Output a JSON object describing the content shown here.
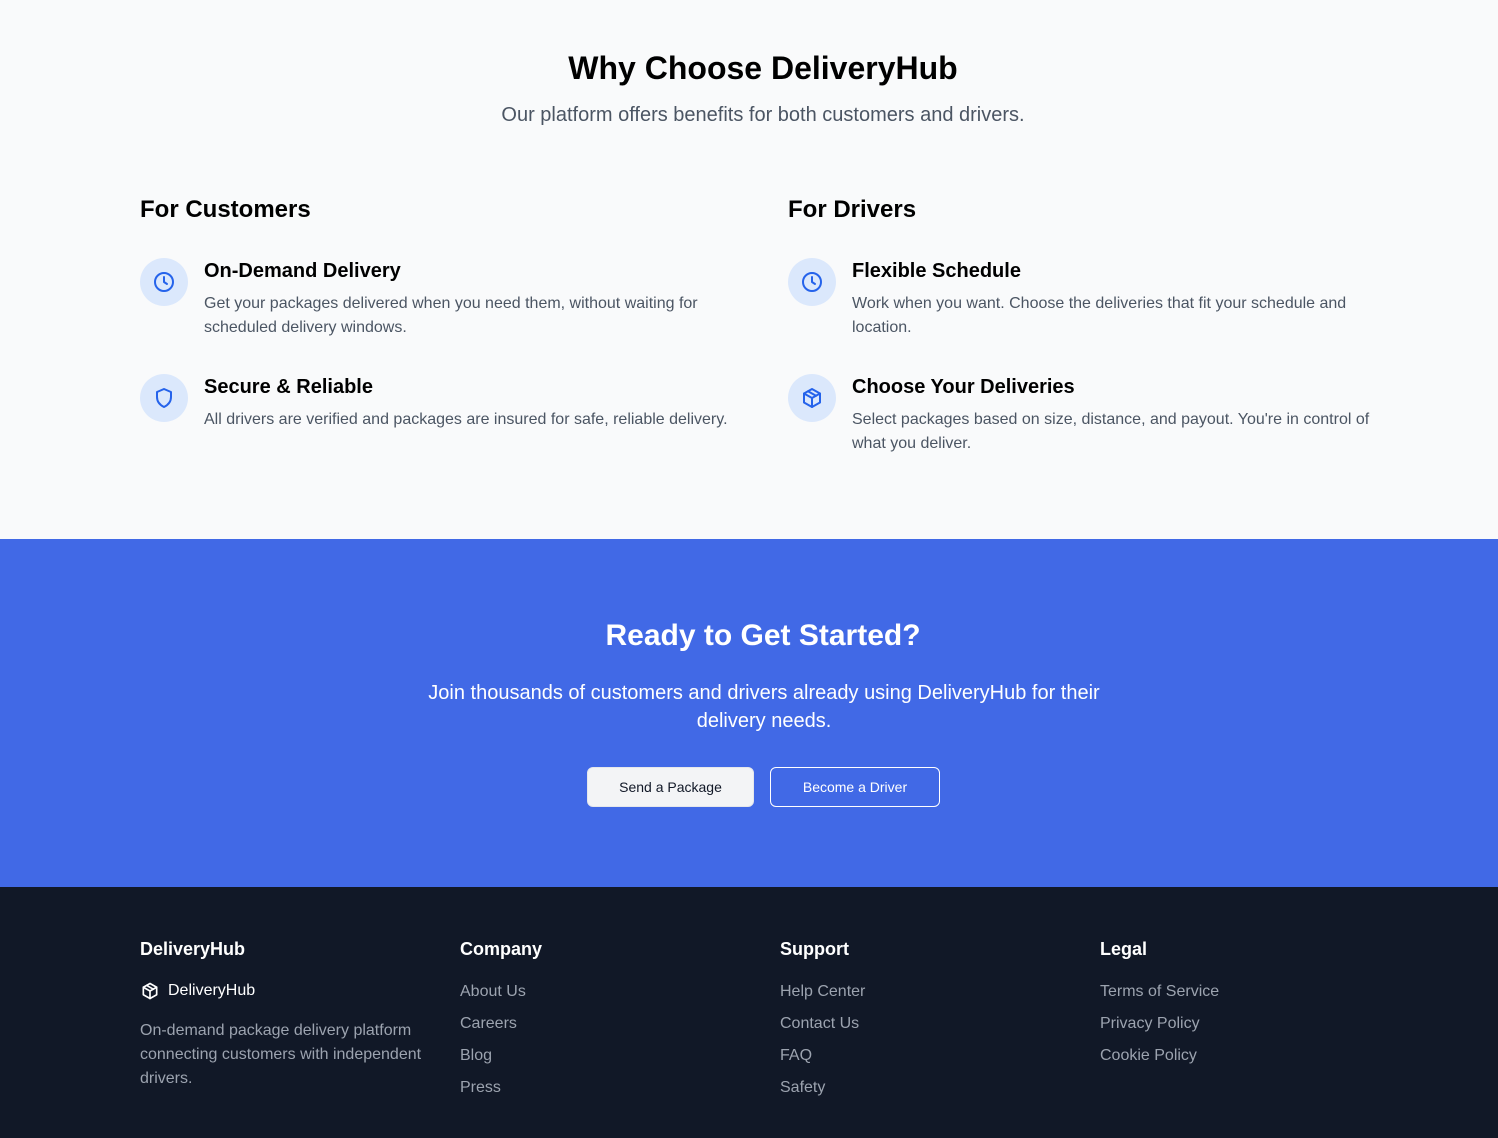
{
  "why": {
    "title": "Why Choose DeliveryHub",
    "subtitle": "Our platform offers benefits for both customers and drivers."
  },
  "customers": {
    "heading": "For Customers",
    "features": [
      {
        "icon": "clock-icon",
        "title": "On-Demand Delivery",
        "desc": "Get your packages delivered when you need them, without waiting for scheduled delivery windows."
      },
      {
        "icon": "shield-icon",
        "title": "Secure & Reliable",
        "desc": "All drivers are verified and packages are insured for safe, reliable delivery."
      }
    ]
  },
  "drivers": {
    "heading": "For Drivers",
    "features": [
      {
        "icon": "clock-icon",
        "title": "Flexible Schedule",
        "desc": "Work when you want. Choose the deliveries that fit your schedule and location."
      },
      {
        "icon": "package-icon",
        "title": "Choose Your Deliveries",
        "desc": "Select packages based on size, distance, and payout. You're in control of what you deliver."
      }
    ]
  },
  "cta": {
    "title": "Ready to Get Started?",
    "subtitle": "Join thousands of customers and drivers already using DeliveryHub for their delivery needs.",
    "primary_label": "Send a Package",
    "secondary_label": "Become a Driver"
  },
  "footer": {
    "brand": {
      "heading": "DeliveryHub",
      "logo_text": "DeliveryHub",
      "description": "On-demand package delivery platform connecting customers with independent drivers."
    },
    "company": {
      "heading": "Company",
      "links": [
        "About Us",
        "Careers",
        "Blog",
        "Press"
      ]
    },
    "support": {
      "heading": "Support",
      "links": [
        "Help Center",
        "Contact Us",
        "FAQ",
        "Safety"
      ]
    },
    "legal": {
      "heading": "Legal",
      "links": [
        "Terms of Service",
        "Privacy Policy",
        "Cookie Policy"
      ]
    }
  },
  "colors": {
    "accent": "#4169e6",
    "footer_bg": "#111827",
    "icon_bg": "#dbe8fc"
  }
}
